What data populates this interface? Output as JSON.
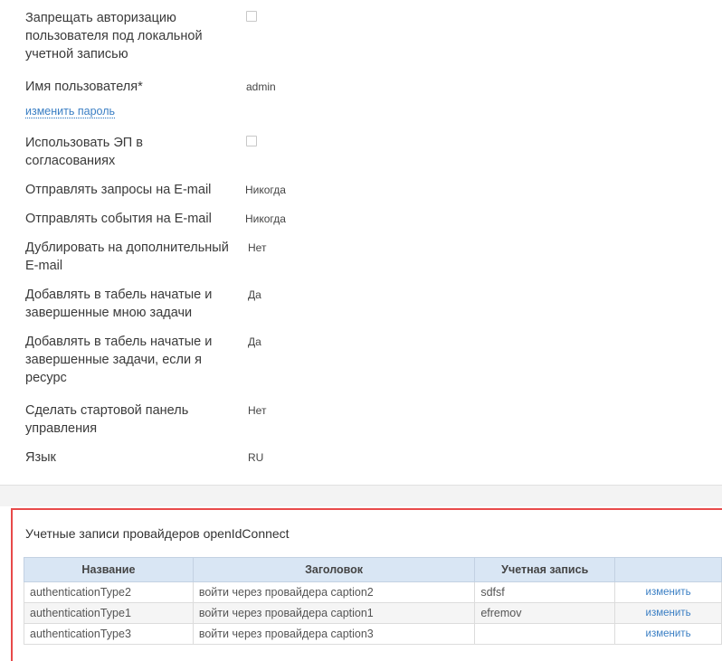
{
  "settings": {
    "forbid_local_auth": {
      "label": "Запрещать авторизацию пользователя под локальной учетной записью"
    },
    "username": {
      "label": "Имя пользователя*",
      "value": "admin"
    },
    "change_password_link": "изменить пароль",
    "use_ep": {
      "label": "Использовать ЭП в согласованиях"
    },
    "send_requests": {
      "label": "Отправлять запросы на E-mail",
      "value": "Никогда"
    },
    "send_events": {
      "label": "Отправлять события на E-mail",
      "value": "Никогда"
    },
    "duplicate_email": {
      "label": "Дублировать на дополнительный E-mail",
      "value": "Нет"
    },
    "add_started_by_me": {
      "label": "Добавлять в табель начатые и завершенные мною задачи",
      "value": "Да"
    },
    "add_started_if_resource": {
      "label": "Добавлять в табель начатые и завершенные задачи, если я ресурс",
      "value": "Да"
    },
    "start_panel": {
      "label": "Сделать стартовой панель управления",
      "value": "Нет"
    },
    "language": {
      "label": "Язык",
      "value": "RU"
    }
  },
  "oidc": {
    "title": "Учетные записи провайдеров openIdConnect",
    "columns": [
      "Название",
      "Заголовок",
      "Учетная запись",
      ""
    ],
    "rows": [
      {
        "name": "authenticationType2",
        "caption": "войти через провайдера caption2",
        "account": "sdfsf",
        "action": "изменить"
      },
      {
        "name": "authenticationType1",
        "caption": "войти через провайдера caption1",
        "account": "efremov",
        "action": "изменить"
      },
      {
        "name": "authenticationType3",
        "caption": "войти через провайдера caption3",
        "account": "",
        "action": "изменить"
      }
    ]
  }
}
